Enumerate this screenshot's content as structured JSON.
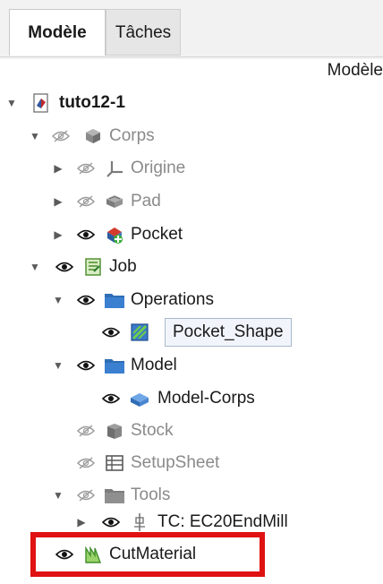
{
  "tabs": [
    {
      "label": "Modèle",
      "active": true
    },
    {
      "label": "Tâches",
      "active": false
    }
  ],
  "panel_header": "Modèle",
  "tree": [
    {
      "label": "tuto12-1",
      "icon": "document-icon",
      "eye": "none",
      "expanded": true,
      "depth": 0
    },
    {
      "label": "Corps",
      "icon": "body-icon",
      "eye": "hidden",
      "expanded": true,
      "depth": 1
    },
    {
      "label": "Origine",
      "icon": "origin-axes-icon",
      "eye": "hidden",
      "expanded": false,
      "depth": 2
    },
    {
      "label": "Pad",
      "icon": "pad-icon",
      "eye": "hidden",
      "expanded": false,
      "depth": 2
    },
    {
      "label": "Pocket",
      "icon": "pocket-icon",
      "eye": "visible",
      "expanded": false,
      "depth": 2
    },
    {
      "label": "Job",
      "icon": "job-icon",
      "eye": "visible",
      "expanded": true,
      "depth": 1
    },
    {
      "label": "Operations",
      "icon": "folder-icon",
      "eye": "visible",
      "expanded": true,
      "depth": 2
    },
    {
      "label": "Pocket_Shape",
      "icon": "pocket-shape-icon",
      "eye": "visible",
      "selected": true,
      "depth": 3
    },
    {
      "label": "Model",
      "icon": "folder-icon",
      "eye": "visible",
      "expanded": true,
      "depth": 2
    },
    {
      "label": "Model-Corps",
      "icon": "model-body-icon",
      "eye": "visible",
      "depth": 3
    },
    {
      "label": "Stock",
      "icon": "stock-icon",
      "eye": "hidden",
      "depth": 2
    },
    {
      "label": "SetupSheet",
      "icon": "setup-sheet-icon",
      "eye": "hidden",
      "depth": 2
    },
    {
      "label": "Tools",
      "icon": "folder-icon",
      "eye": "hidden",
      "expanded": true,
      "depth": 2
    },
    {
      "label": "TC: EC20EndMill",
      "icon": "tool-controller-icon",
      "eye": "visible",
      "expanded": false,
      "depth": 3
    },
    {
      "label": "CutMaterial",
      "icon": "cut-material-icon",
      "eye": "visible",
      "depth": 1,
      "highlighted": true
    }
  ],
  "colors": {
    "highlight": "#e01212",
    "folder": "#2f6db5",
    "selection_bg": "#f1f5fb"
  }
}
